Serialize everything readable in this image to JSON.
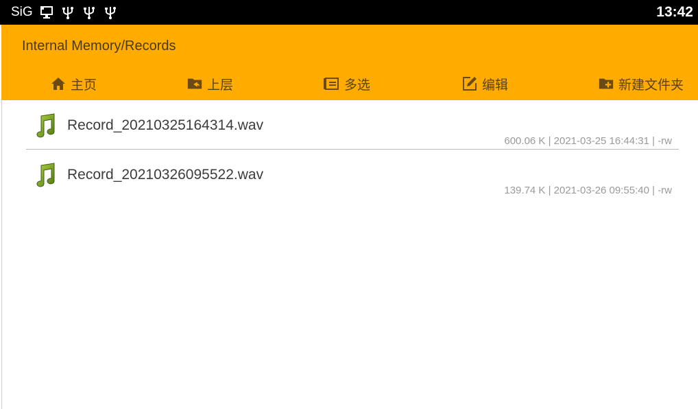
{
  "status_bar": {
    "carrier": "SiG",
    "icons": [
      "screen-share-icon",
      "usb-icon",
      "usb-icon",
      "usb-icon"
    ],
    "time": "13:42"
  },
  "app_bar": {
    "path": "Internal Memory/Records",
    "background": "#ffab00"
  },
  "toolbar": {
    "home_label": "主页",
    "up_label": "上层",
    "multi_select_label": "多选",
    "edit_label": "编辑",
    "new_folder_label": "新建文件夹"
  },
  "files": [
    {
      "name": "Record_20210325164314.wav",
      "meta": "600.06 K | 2021-03-25 16:44:31 | -rw",
      "icon": "music-note-icon"
    },
    {
      "name": "Record_20210326095522.wav",
      "meta": "139.74 K | 2021-03-26 09:55:40 | -rw",
      "icon": "music-note-icon"
    }
  ]
}
